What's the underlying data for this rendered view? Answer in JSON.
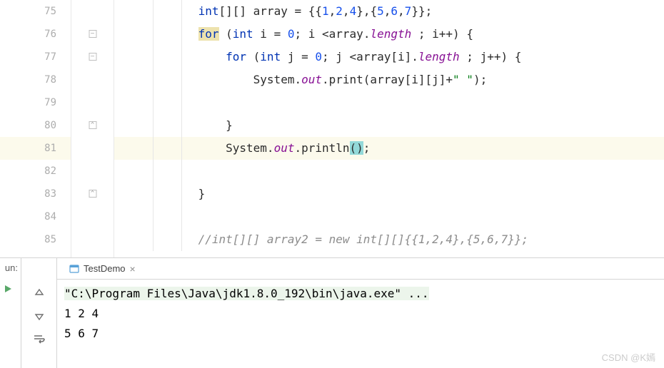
{
  "gutter": [
    "75",
    "76",
    "77",
    "78",
    "79",
    "80",
    "81",
    "82",
    "83",
    "84",
    "85"
  ],
  "code": {
    "l75": {
      "indent": "            ",
      "t1": "int",
      "t2": "[][] array = {{",
      "n1": "1",
      "c1": ",",
      "n2": "2",
      "c2": ",",
      "n3": "4",
      "c3": "},{",
      "n4": "5",
      "c4": ",",
      "n5": "6",
      "c5": ",",
      "n6": "7",
      "c6": "}};"
    },
    "l76": {
      "indent": "            ",
      "for": "for",
      "t1": " (",
      "int": "int",
      "t2": " i = ",
      "n1": "0",
      "t3": "; i <array.",
      "len": "length",
      "t4": " ; i++) {"
    },
    "l77": {
      "indent": "                ",
      "for": "for",
      "t1": " (",
      "int": "int",
      "t2": " j = ",
      "n1": "0",
      "t3": "; j <array[i].",
      "len": "length",
      "t4": " ; j++) {"
    },
    "l78": {
      "indent": "                    ",
      "t1": "System.",
      "out": "out",
      "t2": ".print(array[i][j]+",
      "s1": "\" \"",
      "t3": ");"
    },
    "l79": {
      "indent": ""
    },
    "l80": {
      "indent": "                ",
      "t1": "}"
    },
    "l81": {
      "indent": "                ",
      "t1": "System.",
      "out": "out",
      "t2": ".println",
      "p": "()",
      "t3": ";"
    },
    "l82": {
      "indent": ""
    },
    "l83": {
      "indent": "            ",
      "t1": "}"
    },
    "l84": {
      "indent": ""
    },
    "l85": {
      "indent": "            ",
      "c": "//int[][] array2 = new int[][]{{1,2,4},{5,6,7}};"
    }
  },
  "run": {
    "label": "un:",
    "tab": "TestDemo",
    "cmd": "\"C:\\Program Files\\Java\\jdk1.8.0_192\\bin\\java.exe\" ...",
    "out1": "1 2 4",
    "out2": "5 6 7"
  },
  "watermark": "CSDN @K嫣"
}
